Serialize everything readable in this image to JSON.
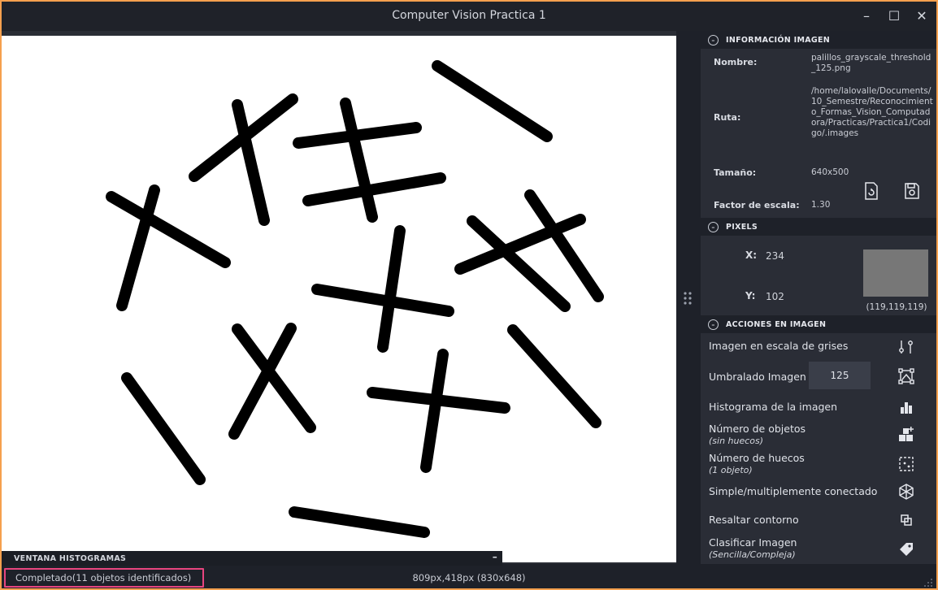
{
  "window": {
    "title": "Computer Vision Practica 1",
    "controls": {
      "minimize": "–",
      "maximize": "☐",
      "close": "✕"
    }
  },
  "histogram_bar": {
    "label": "VENTANA HISTOGRAMAS",
    "minimize": "–"
  },
  "info": {
    "header": "INFORMACIÓN IMAGEN",
    "name_label": "Nombre:",
    "name_value": "palillos_grayscale_threshold_125.png",
    "path_label": "Ruta:",
    "path_value": "/home/lalovalle/Documents/10_Semestre/Reconocimiento_Formas_Vision_Computadora/Practicas/Practica1/Codigo/.images",
    "size_label": "Tamaño:",
    "size_value": "640x500",
    "scale_label": "Factor de escala:",
    "scale_value": "1.30",
    "icons": [
      "reload-file-icon",
      "save-icon"
    ]
  },
  "pixels": {
    "header": "PIXELS",
    "x_label": "X:",
    "x_value": "234",
    "y_label": "Y:",
    "y_value": "102",
    "rgb_label": "(119,119,119)",
    "swatch_color": "#777777"
  },
  "actions": {
    "header": "ACCIONES EN IMAGEN",
    "grayscale": {
      "label": "Imagen en escala de grises",
      "icon": "grayscale-icon"
    },
    "threshold": {
      "label": "Umbralado Imagen",
      "value": "125",
      "icon": "threshold-icon"
    },
    "histogram": {
      "label": "Histograma de la imagen",
      "icon": "histogram-icon"
    },
    "objects": {
      "label": "Número de objetos",
      "sub": "(sin huecos)",
      "icon": "objects-icon"
    },
    "holes": {
      "label": "Número de huecos",
      "sub": "(1 objeto)",
      "icon": "holes-icon"
    },
    "connected": {
      "label": "Simple/multiplemente conectado",
      "icon": "connected-icon"
    },
    "contour": {
      "label": "Resaltar contorno",
      "icon": "contour-icon"
    },
    "classify": {
      "label": "Clasificar Imagen",
      "sub": "(Sencilla/Compleja)",
      "icon": "tag-icon"
    }
  },
  "status": {
    "message": "Completado(11 objetos identificados)",
    "position": "809px,418px (830x648)"
  },
  "colors": {
    "accent_border": "#f5a04e",
    "status_highlight": "#e8457f",
    "background": "#1e2129",
    "panel": "#2a2d36"
  }
}
